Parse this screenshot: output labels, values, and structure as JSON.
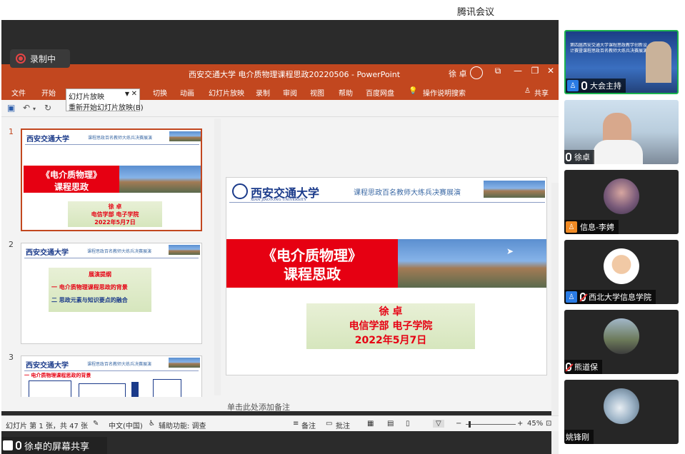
{
  "meeting": {
    "app_title": "腾讯会议",
    "recording_label": "录制中",
    "share_label": "徐卓的屏幕共享"
  },
  "ppt": {
    "doc_title": "西安交通大学  电介质物理课程思政20220506  -  PowerPoint",
    "user_name": "徐 卓",
    "ribbon_tabs": [
      "文件",
      "开始",
      "切换",
      "动画",
      "幻灯片放映",
      "录制",
      "审阅",
      "视图",
      "帮助",
      "百度网盘",
      "操作说明搜索"
    ],
    "share_button": "共享",
    "tooltip": {
      "title": "幻灯片放映",
      "item": "重新开始幻灯片放映(B)"
    },
    "notes_placeholder": "单击此处添加备注",
    "status": {
      "slide_info": "幻灯片 第 1 张，共 47 张",
      "language": "中文(中国)",
      "accessibility": "辅助功能: 调查",
      "notes_btn": "备注",
      "comments_btn": "批注",
      "zoom": "45%"
    }
  },
  "slide1": {
    "logo": "西安交通大学",
    "logo_en": "XIAN JIAOTONG UNIVERSITY",
    "slogan": "课程思政百名教师大练兵决赛展演",
    "title_line1": "《电介质物理》",
    "title_line2": "课程思政",
    "presenter": "徐  卓",
    "department": "电信学部  电子学院",
    "date": "2022年5月7日"
  },
  "slide2": {
    "heading": "展演提纲",
    "item1": "一 电介质物理课程思政的背景",
    "item2": "二 思政元素与知识要点的融合"
  },
  "slide3": {
    "heading": "一 电介质物理课程思政的背景"
  },
  "thumbnails": [
    "1",
    "2",
    "3"
  ],
  "participants": [
    {
      "name": "大会主持",
      "role": "host",
      "banner": "第四届西安交通大学课程思政教学创新设计赛暨课程思政百名教师大练兵决赛展演"
    },
    {
      "name": "徐卓",
      "role": "speaker"
    },
    {
      "name": "信息-李娉",
      "role": "member"
    },
    {
      "name": "西北大学信息学院",
      "role": "member"
    },
    {
      "name": "熊道保",
      "role": "member"
    },
    {
      "name": "姚锋刚",
      "role": "member"
    }
  ],
  "colors": {
    "ppt_accent": "#c2471f",
    "slide_red": "#e60012",
    "active_speaker": "#1bb34e",
    "host_blue": "#2a7be4"
  }
}
